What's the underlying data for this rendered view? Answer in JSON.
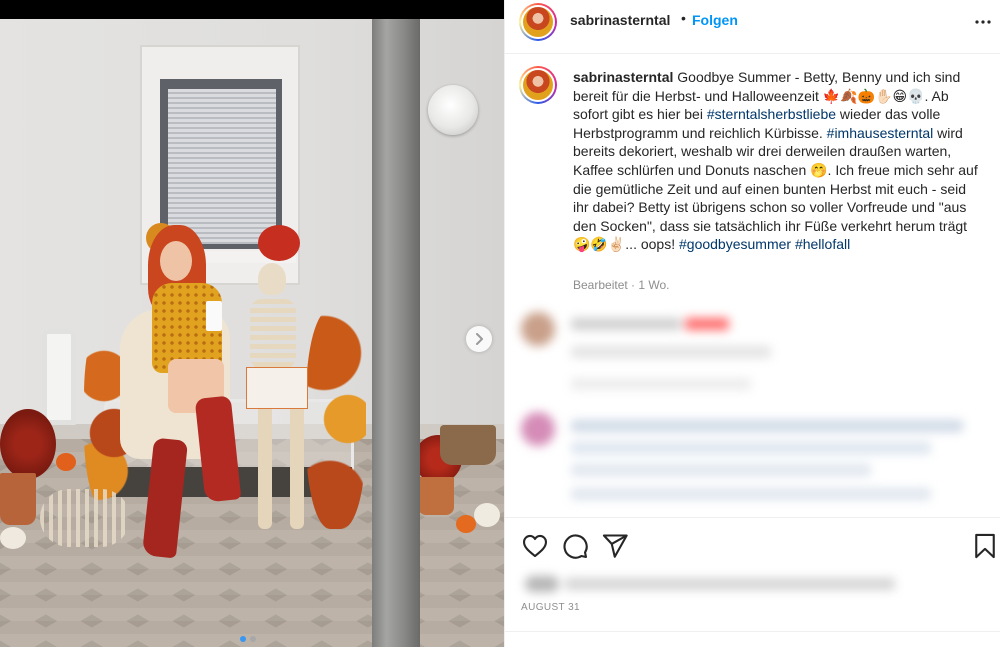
{
  "post": {
    "username": "sabrinasterntal",
    "separator": "•",
    "follow_label": "Folgen",
    "more_icon": "more-options-icon",
    "caption": {
      "segments": [
        {
          "type": "user",
          "text": "sabrinasterntal"
        },
        {
          "type": "text",
          "text": " Goodbye Summer - Betty, Benny und ich sind bereit für die Herbst- und Halloweenzeit 🍁🍂🎃✋🏻😁💀. Ab sofort gibt es hier bei "
        },
        {
          "type": "tag",
          "text": "#sterntalsherbstliebe"
        },
        {
          "type": "text",
          "text": " wieder das volle Herbstprogramm und reichlich Kürbisse. "
        },
        {
          "type": "tag",
          "text": "#imhausesterntal"
        },
        {
          "type": "text",
          "text": " wird bereits dekoriert, weshalb wir drei derweilen draußen warten, Kaffee schlürfen und Donuts naschen 🤭. Ich freue mich sehr auf die gemütliche Zeit und auf einen bunten Herbst mit euch - seid ihr dabei? Betty ist übrigens schon so voller Vorfreude und \"aus den Socken\", dass sie tatsächlich ihr Füße verkehrt herum trägt 🤪🤣✌🏻... oops! "
        },
        {
          "type": "tag",
          "text": "#goodbyesummer"
        },
        {
          "type": "text",
          "text": " "
        },
        {
          "type": "tag",
          "text": "#hellofall"
        }
      ]
    },
    "edited_label": "Bearbeitet · 1 Wo.",
    "date": "AUGUST 31"
  },
  "carousel": {
    "next_icon": "chevron-right-icon",
    "slide_count": 2,
    "active_index": 0
  },
  "actions": {
    "like_icon": "heart-icon",
    "comment_icon": "comment-icon",
    "share_icon": "paper-plane-icon",
    "save_icon": "bookmark-icon"
  },
  "colors": {
    "follow": "#0095f6",
    "hashtag": "#00376b",
    "muted": "#8e8e8e"
  }
}
